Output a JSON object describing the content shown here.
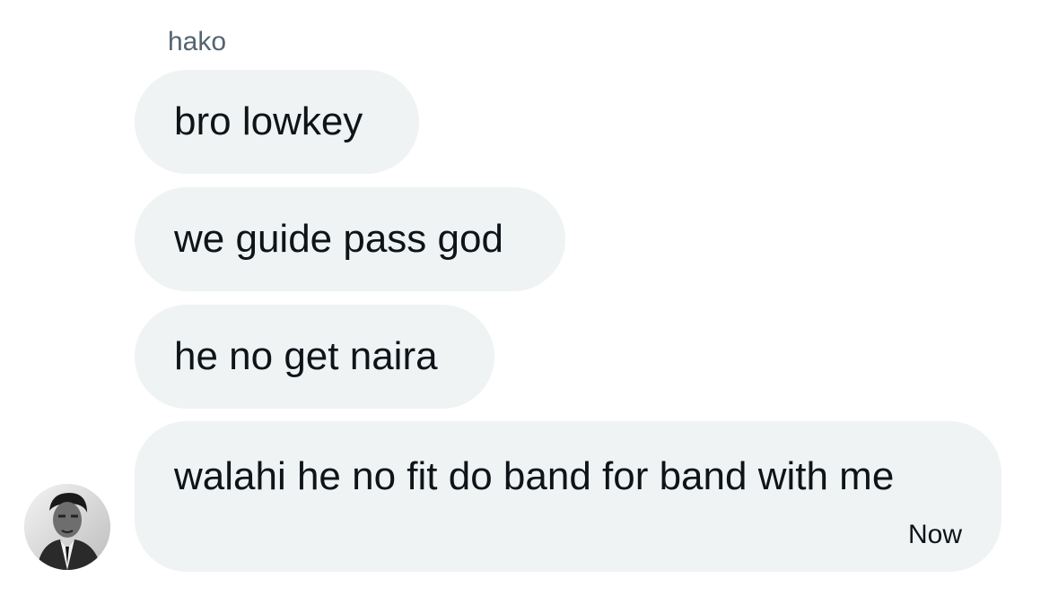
{
  "conversation": {
    "sender_name": "hako",
    "messages": [
      {
        "text": "bro lowkey"
      },
      {
        "text": "we guide pass god"
      },
      {
        "text": "he no get naira"
      },
      {
        "text": "walahi he no fit do band for band with me",
        "timestamp": "Now"
      }
    ]
  },
  "avatar": {
    "icon": "user-avatar-photo"
  },
  "colors": {
    "bubble_bg": "#eff3f4",
    "text": "#0f1419",
    "muted_text": "#536471",
    "background": "#ffffff"
  }
}
